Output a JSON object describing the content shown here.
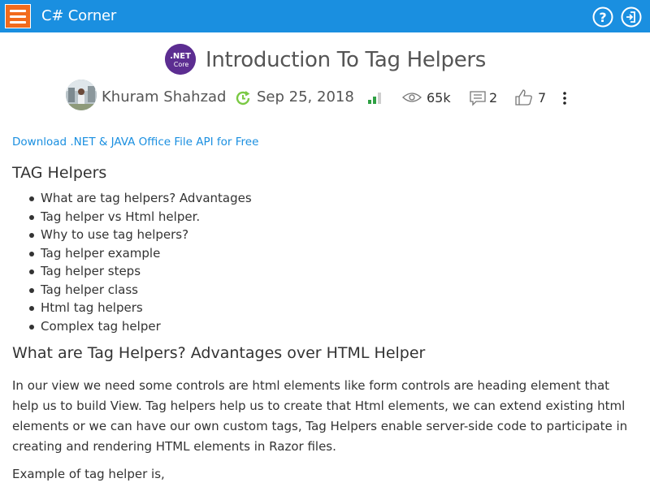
{
  "colors": {
    "topbar_bg": "#1a8fe0",
    "menu_bg": "#f26b1d",
    "link": "#1a8fe0",
    "net_logo_bg": "#5c2d91",
    "level_green": "#2ea043"
  },
  "header": {
    "brand": "C# Corner",
    "menu_icon": "hamburger-icon",
    "help_icon": "question-circle-icon",
    "login_icon": "login-icon"
  },
  "article": {
    "logo_text_top": ".NET",
    "logo_text_bottom": "Core",
    "title": "Introduction To Tag Helpers",
    "author": "Khuram Shahzad",
    "date": "Sep 25, 2018",
    "views": "65k",
    "comments": "2",
    "likes": "7"
  },
  "ad": {
    "text": "Download .NET & JAVA Office File API for Free"
  },
  "content": {
    "heading1": "TAG Helpers",
    "toc": [
      "What are tag helpers? Advantages",
      "Tag helper vs Html helper.",
      "Why to use tag helpers?",
      "Tag helper example",
      "Tag helper steps",
      "Tag helper class",
      "Html tag helpers",
      "Complex tag helper"
    ],
    "heading2": "What are Tag Helpers? Advantages over HTML Helper",
    "paragraph1": "In our view we need some controls are html elements like form controls are heading element that help us to build View. Tag helpers help us to create that Html elements, we can extend existing html elements or we can have our own custom tags, Tag Helpers enable server-side code to participate in creating and rendering HTML elements in Razor files.",
    "paragraph2": "Example of tag helper is,"
  }
}
